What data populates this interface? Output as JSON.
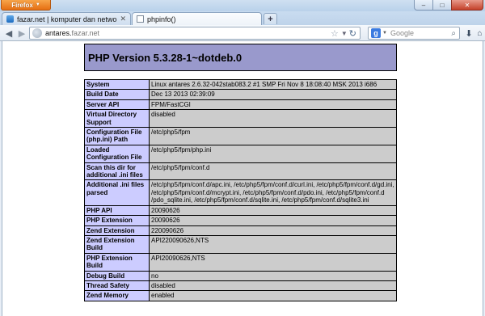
{
  "browser": {
    "app_button_label": "Firefox",
    "window_controls": {
      "minimize": "–",
      "maximize": "□",
      "close": "✕"
    },
    "tabs": [
      {
        "title": "fazar.net | komputer dan networking",
        "active": false
      },
      {
        "title": "phpinfo()",
        "active": true
      }
    ],
    "new_tab_label": "+",
    "url": {
      "host": "antares.",
      "rest": "fazar.net"
    },
    "search": {
      "engine_letter": "g",
      "placeholder": "Google"
    }
  },
  "page": {
    "header_title": "PHP Version 5.3.28-1~dotdeb.0",
    "rows": [
      {
        "label": "System",
        "value": "Linux antares 2.6.32-042stab083.2 #1 SMP Fri Nov 8 18:08:40 MSK 2013 i686"
      },
      {
        "label": "Build Date",
        "value": "Dec 13 2013 02:39:09"
      },
      {
        "label": "Server API",
        "value": "FPM/FastCGI"
      },
      {
        "label": "Virtual Directory Support",
        "value": "disabled"
      },
      {
        "label": "Configuration File (php.ini) Path",
        "value": "/etc/php5/fpm"
      },
      {
        "label": "Loaded Configuration File",
        "value": "/etc/php5/fpm/php.ini"
      },
      {
        "label": "Scan this dir for additional .ini files",
        "value": "/etc/php5/fpm/conf.d"
      },
      {
        "label": "Additional .ini files parsed",
        "value": "/etc/php5/fpm/conf.d/apc.ini, /etc/php5/fpm/conf.d/curl.ini, /etc/php5/fpm/conf.d/gd.ini, /etc/php5/fpm/conf.d/mcrypt.ini, /etc/php5/fpm/conf.d/pdo.ini, /etc/php5/fpm/conf.d /pdo_sqlite.ini, /etc/php5/fpm/conf.d/sqlite.ini, /etc/php5/fpm/conf.d/sqlite3.ini"
      },
      {
        "label": "PHP API",
        "value": "20090626"
      },
      {
        "label": "PHP Extension",
        "value": "20090626"
      },
      {
        "label": "Zend Extension",
        "value": "220090626"
      },
      {
        "label": "Zend Extension Build",
        "value": "API220090626,NTS"
      },
      {
        "label": "PHP Extension Build",
        "value": "API20090626,NTS"
      },
      {
        "label": "Debug Build",
        "value": "no"
      },
      {
        "label": "Thread Safety",
        "value": "disabled"
      },
      {
        "label": "Zend Memory",
        "value": "enabled"
      }
    ]
  }
}
